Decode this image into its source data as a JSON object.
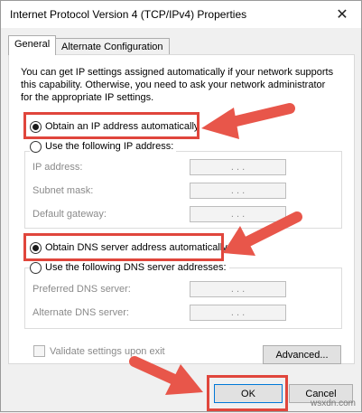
{
  "window": {
    "title": "Internet Protocol Version 4 (TCP/IPv4) Properties"
  },
  "tabs": [
    {
      "label": "General",
      "active": true
    },
    {
      "label": "Alternate Configuration",
      "active": false
    }
  ],
  "intro_text": "You can get IP settings assigned automatically if your network supports this capability. Otherwise, you need to ask your network administrator for the appropriate IP settings.",
  "ip_section": {
    "auto_label": "Obtain an IP address automatically",
    "auto_selected": true,
    "manual_label": "Use the following IP address:",
    "fields": [
      {
        "label": "IP address:",
        "value": ". . ."
      },
      {
        "label": "Subnet mask:",
        "value": ". . ."
      },
      {
        "label": "Default gateway:",
        "value": ". . ."
      }
    ]
  },
  "dns_section": {
    "auto_label": "Obtain DNS server address automatically",
    "auto_selected": true,
    "manual_label": "Use the following DNS server addresses:",
    "fields": [
      {
        "label": "Preferred DNS server:",
        "value": ". . ."
      },
      {
        "label": "Alternate DNS server:",
        "value": ". . ."
      }
    ]
  },
  "validate_label": "Validate settings upon exit",
  "buttons": {
    "advanced": "Advanced...",
    "ok": "OK",
    "cancel": "Cancel"
  },
  "watermark": "wsxdn.com",
  "colors": {
    "highlight": "#e0463c",
    "arrow": "#e8564a"
  }
}
